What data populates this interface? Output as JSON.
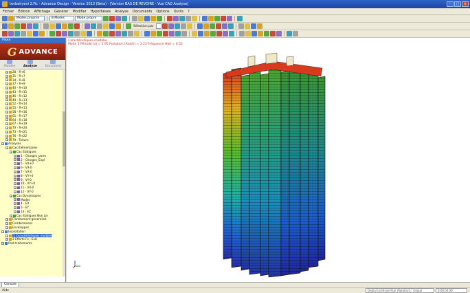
{
  "window": {
    "title": "tevbahyeni 2.Fic - Advance Design - Version 2013 (Beta) - [Version BAS DE REVOIRE - Vue CAO Analyse]"
  },
  "menu": [
    "Fichier",
    "Édition",
    "Affichage",
    "Générer",
    "Modifier",
    "Hypothèses",
    "Analyse",
    "Documents",
    "Options",
    "Outils",
    "?"
  ],
  "toolbar": {
    "combo1": "Modes propres",
    "combo2": "8 Modes",
    "combo3": "Mode propre",
    "selection_label": "Sélection par"
  },
  "panel": {
    "header": "Pilote",
    "logo_g": "G",
    "logo_text": "ADVANCE",
    "tabs": [
      {
        "label": "Modèle",
        "active": false
      },
      {
        "label": "Analyse",
        "active": true
      },
      {
        "label": "Document",
        "active": false
      }
    ]
  },
  "tree": [
    {
      "label": "28 - R+6",
      "indent": 1
    },
    {
      "label": "31 - R+7",
      "indent": 1
    },
    {
      "label": "34 - R+8",
      "indent": 1
    },
    {
      "label": "37 - R+9",
      "indent": 1
    },
    {
      "label": "40 - R+10",
      "indent": 1
    },
    {
      "label": "43 - R+11",
      "indent": 1
    },
    {
      "label": "46 - R+12",
      "indent": 1
    },
    {
      "label": "49 - R+13",
      "indent": 1
    },
    {
      "label": "52 - R+14",
      "indent": 1
    },
    {
      "label": "55 - R+15",
      "indent": 1
    },
    {
      "label": "58 - R+16",
      "indent": 1
    },
    {
      "label": "61 - R+17",
      "indent": 1
    },
    {
      "label": "64 - R+18",
      "indent": 1
    },
    {
      "label": "67 - R+19",
      "indent": 1
    },
    {
      "label": "70 - R+20",
      "indent": 1
    },
    {
      "label": "73 - R+21",
      "indent": 1
    },
    {
      "label": "76 - R+22",
      "indent": 1
    },
    {
      "label": "79 - Toiture",
      "indent": 1
    },
    {
      "label": "Analyses",
      "indent": 0
    },
    {
      "label": "Cas Élémentaires",
      "indent": 1
    },
    {
      "label": "Cas Statiques",
      "indent": 2
    },
    {
      "label": "1 - Charges_perm",
      "indent": 3
    },
    {
      "label": "2 - Charges_Expl",
      "indent": 3
    },
    {
      "label": "5 - VX+0",
      "indent": 3
    },
    {
      "label": "6 - VX-0",
      "indent": 3
    },
    {
      "label": "7 - VX-0",
      "indent": 3
    },
    {
      "label": "8 - VY+0",
      "indent": 3
    },
    {
      "label": "9 - VY-0",
      "indent": 3
    },
    {
      "label": "10 - VY+0",
      "indent": 3
    },
    {
      "label": "11 - VX-0",
      "indent": 3
    },
    {
      "label": "12 - VY-0",
      "indent": 3
    },
    {
      "label": "Cas Dynamiques",
      "indent": 2
    },
    {
      "label": "Modes",
      "indent": 3
    },
    {
      "label": "4 - EX",
      "indent": 3
    },
    {
      "label": "5 - EY",
      "indent": 3
    },
    {
      "label": "13 - EZ",
      "indent": 3
    },
    {
      "label": "Cas Statiques Non Lin",
      "indent": 2
    },
    {
      "label": "Flambement généralisé",
      "indent": 1
    },
    {
      "label": "Combinaisons",
      "indent": 1
    },
    {
      "label": "Enveloppes",
      "indent": 1
    },
    {
      "label": "Exploitation",
      "indent": 0
    },
    {
      "label": "1 Caractéristiques modale",
      "indent": 1,
      "selected": true
    },
    {
      "label": "2 Efforts Fx : ELU",
      "indent": 1
    },
    {
      "label": "Post-traitements",
      "indent": 0
    }
  ],
  "viewport": {
    "info_line1": "Caractéristiques modales",
    "info_line2": "Mode 1 Période (s) = 1.95 Pulsation (Rad/s) = 3.23 Fréquence (Hz) = 0.52"
  },
  "bottom_tab": "Console",
  "status": {
    "text": "Aide",
    "coord_hint": "Global cartésien/Vue (Rotation) / Global",
    "coord_value": "0.00.00.00"
  },
  "colors": {
    "title_bar": "#1f4fb0",
    "tree_bg": "#ffffc8",
    "accent_red": "#d0301c"
  }
}
